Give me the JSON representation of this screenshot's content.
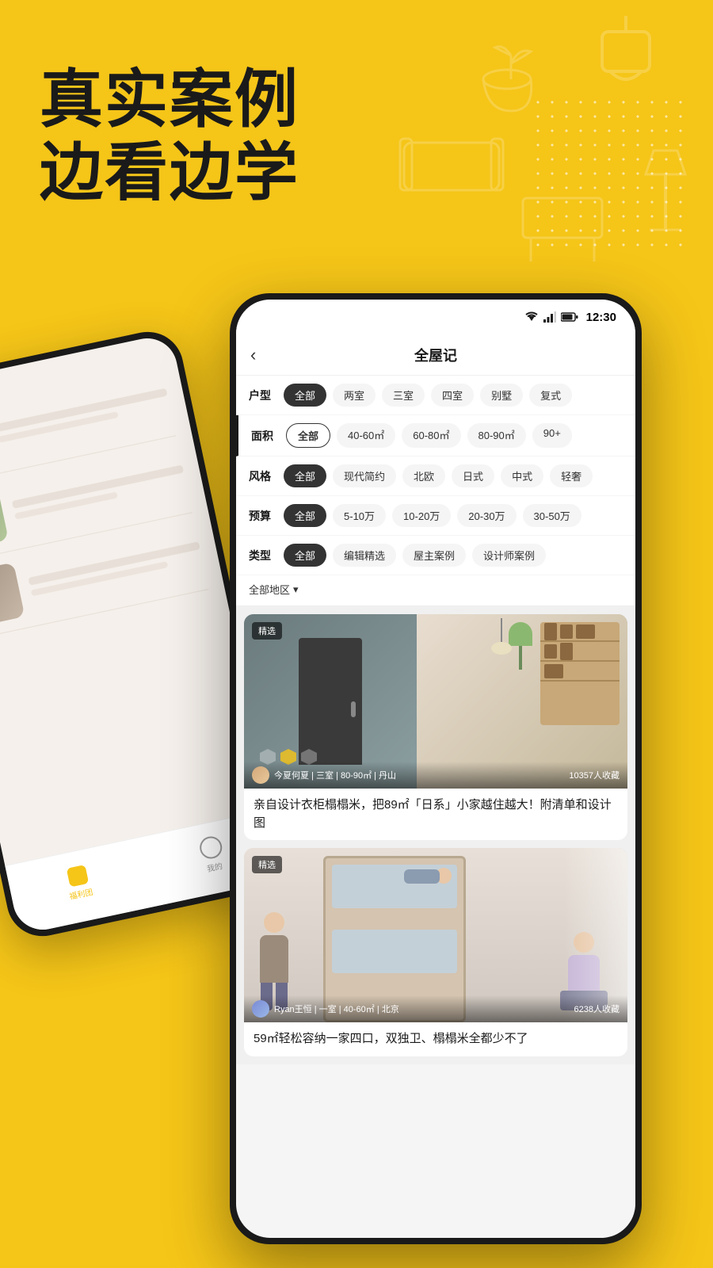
{
  "background": {
    "color": "#F5C518"
  },
  "headline": {
    "line1": "真实案例",
    "line2": "边看边学"
  },
  "statusBar": {
    "time": "12:30",
    "wifi": "▼",
    "signal": "▲",
    "battery": "🔋"
  },
  "appHeader": {
    "backLabel": "‹",
    "title": "全屋记"
  },
  "filters": {
    "row1": {
      "label": "户型",
      "chips": [
        "全部",
        "两室",
        "三室",
        "四室",
        "别墅",
        "复式"
      ]
    },
    "row2": {
      "label": "面积",
      "chips": [
        "全部",
        "40-60㎡",
        "60-80㎡",
        "80-90㎡",
        "90+"
      ]
    },
    "row3": {
      "label": "风格",
      "chips": [
        "全部",
        "现代简约",
        "北欧",
        "日式",
        "中式",
        "轻奢"
      ]
    },
    "row4": {
      "label": "预算",
      "chips": [
        "全部",
        "5-10万",
        "10-20万",
        "20-30万",
        "30-50万"
      ]
    },
    "row5": {
      "label": "类型",
      "chips": [
        "全部",
        "编辑精选",
        "屋主案例",
        "设计师案例"
      ]
    }
  },
  "regionButton": {
    "label": "全部地区",
    "arrow": "▾"
  },
  "cards": [
    {
      "badge": "精选",
      "avatar": "",
      "author": "今夏何夏",
      "meta": "三室 | 80-90㎡ | 丹山",
      "saves": "10357人收藏",
      "title": "亲自设计衣柜榻榻米，把89㎡「日系」小家越住越大！附清单和设计图"
    },
    {
      "badge": "精选",
      "avatar": "",
      "author": "Ryan王恒",
      "meta": "一室 | 40-60㎡ | 北京",
      "saves": "6238人收藏",
      "title": "59㎡轻松容纳一家四口，双独卫、榻榻米全都少不了"
    }
  ],
  "backPhone": {
    "navItems": [
      {
        "label": "福利团",
        "active": true
      },
      {
        "label": "我的",
        "active": false
      }
    ]
  }
}
